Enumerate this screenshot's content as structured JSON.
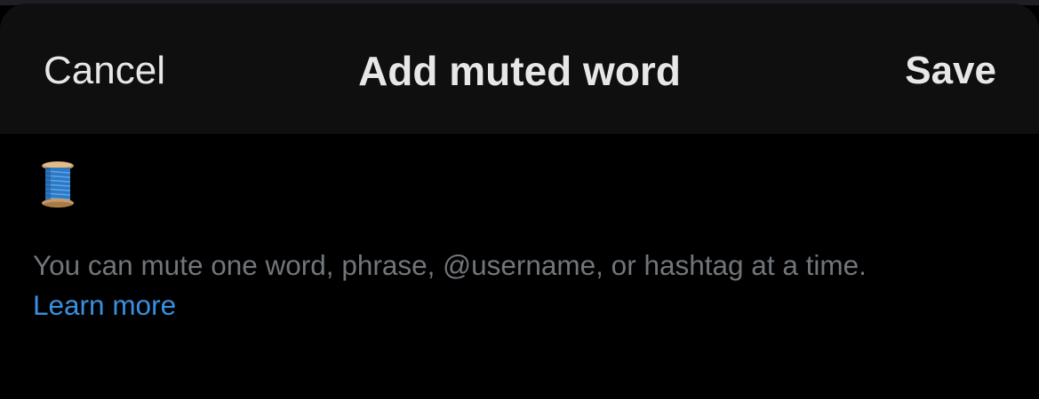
{
  "header": {
    "cancel_label": "Cancel",
    "title": "Add muted word",
    "save_label": "Save"
  },
  "body": {
    "icon": "thread-spool-icon",
    "help_text": "You can mute one word, phrase, @username, or hashtag at a time.",
    "learn_more_label": "Learn more"
  },
  "colors": {
    "background": "#000000",
    "header_background": "#0f0f10",
    "header_text": "#e7e7e7",
    "secondary_text": "#71767b",
    "link": "#3b8fe0"
  }
}
